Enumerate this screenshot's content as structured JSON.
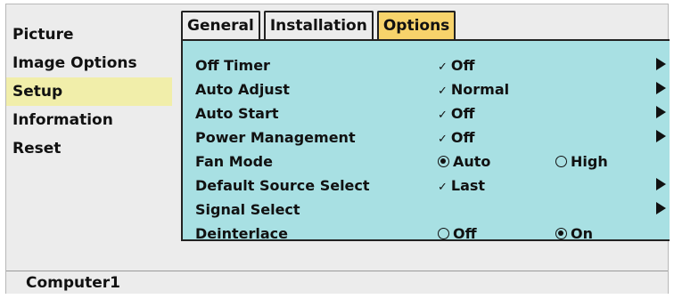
{
  "sidebar": {
    "items": [
      {
        "label": "Picture"
      },
      {
        "label": "Image Options"
      },
      {
        "label": "Setup"
      },
      {
        "label": "Information"
      },
      {
        "label": "Reset"
      }
    ]
  },
  "tabs": [
    {
      "label": "General"
    },
    {
      "label": "Installation"
    },
    {
      "label": "Options"
    }
  ],
  "options": {
    "off_timer": {
      "label": "Off Timer",
      "value": "Off"
    },
    "auto_adjust": {
      "label": "Auto Adjust",
      "value": "Normal"
    },
    "auto_start": {
      "label": "Auto Start",
      "value": "Off"
    },
    "power_management": {
      "label": "Power Management",
      "value": "Off"
    },
    "fan_mode": {
      "label": "Fan Mode",
      "option1": "Auto",
      "option2": "High"
    },
    "default_source_select": {
      "label": "Default Source Select",
      "value": "Last"
    },
    "signal_select": {
      "label": "Signal Select"
    },
    "deinterlace": {
      "label": "Deinterlace",
      "option1": "Off",
      "option2": "On"
    }
  },
  "status": {
    "source": "Computer1"
  }
}
